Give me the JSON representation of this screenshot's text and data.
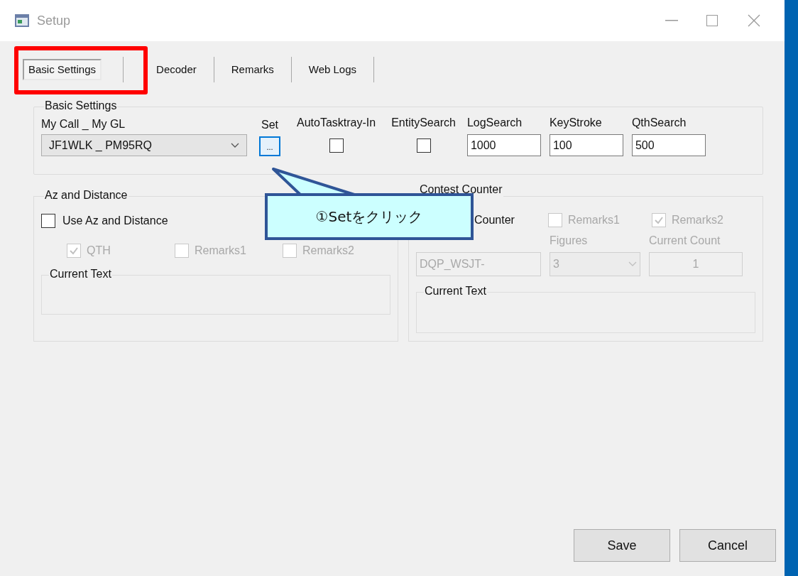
{
  "window": {
    "title": "Setup"
  },
  "tabs": [
    {
      "label": "Basic Settings",
      "selected": true
    },
    {
      "label": "Decoder",
      "selected": false
    },
    {
      "label": "Remarks",
      "selected": false
    },
    {
      "label": "Web Logs",
      "selected": false
    }
  ],
  "basic_settings": {
    "legend": "Basic Settings",
    "my_call_label": "My Call _ My GL",
    "my_call_value": "JF1WLK _ PM95RQ",
    "set_label": "Set",
    "set_button": "...",
    "options": [
      {
        "kind": "checkbox",
        "label": "AutoTasktray-In",
        "checked": false
      },
      {
        "kind": "checkbox",
        "label": "EntitySearch",
        "checked": false
      },
      {
        "kind": "field",
        "label": "LogSearch",
        "value": "1000"
      },
      {
        "kind": "field",
        "label": "KeyStroke",
        "value": "100"
      },
      {
        "kind": "field",
        "label": "QthSearch",
        "value": "500"
      }
    ]
  },
  "az_distance": {
    "legend": "Az and Distance",
    "use": {
      "label": "Use Az and Distance",
      "checked": false
    },
    "options": [
      {
        "label": "QTH",
        "checked": true,
        "disabled": true
      },
      {
        "label": "Remarks1",
        "checked": false,
        "disabled": true
      },
      {
        "label": "Remarks2",
        "checked": false,
        "disabled": true
      }
    ],
    "current_text_legend": "Current Text"
  },
  "contest_counter": {
    "legend": "Contest Counter",
    "use_label": "Counter",
    "options": [
      {
        "label": "Remarks1",
        "checked": false,
        "disabled": true
      },
      {
        "label": "Remarks2",
        "checked": true,
        "disabled": true
      }
    ],
    "prefix_value": "DQP_WSJT-",
    "figures_label": "Figures",
    "figures_value": "3",
    "count_label": "Current Count",
    "count_value": "1",
    "current_text_legend": "Current Text"
  },
  "callout": {
    "text": "①Setをクリック"
  },
  "buttons": [
    "Save",
    "Cancel"
  ]
}
